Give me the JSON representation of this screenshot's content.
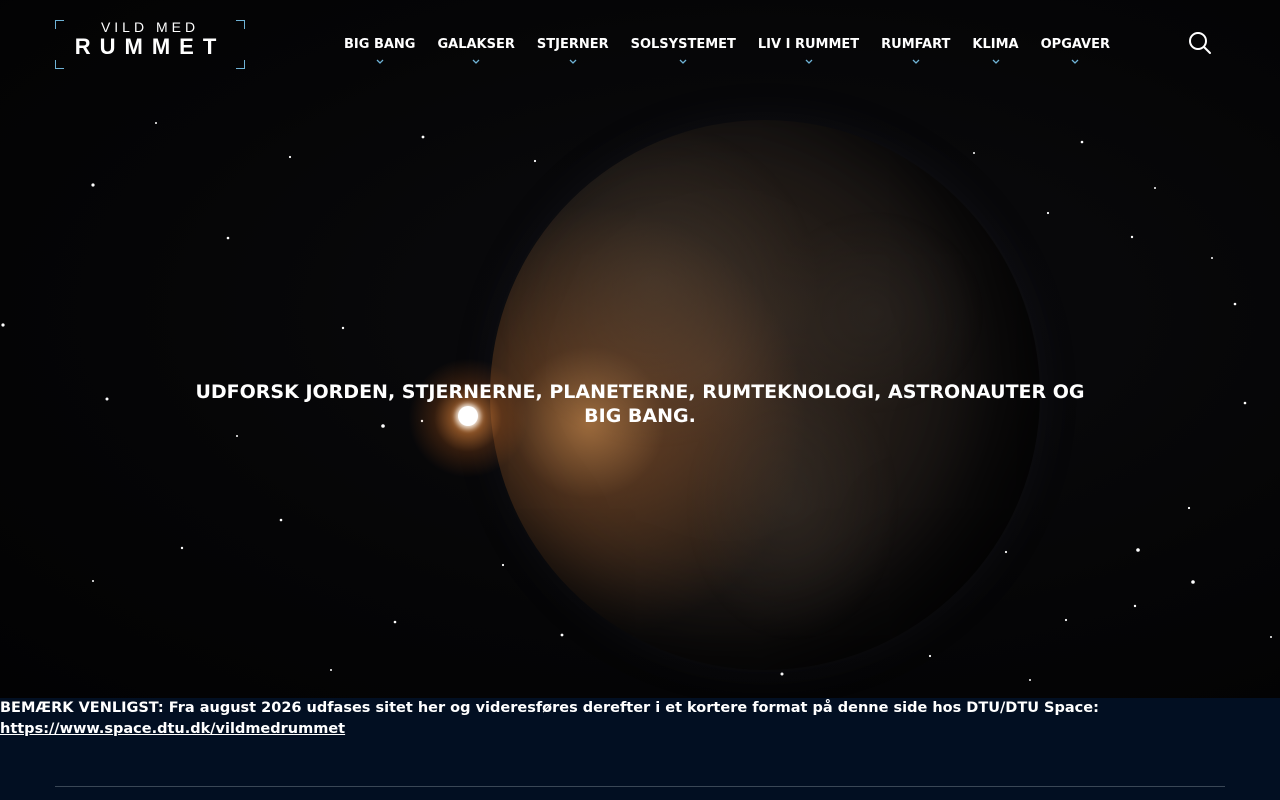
{
  "colors": {
    "background": "#000000",
    "notice_background": "#020f22",
    "accent": "#6fb3d6",
    "text": "#ffffff"
  },
  "logo": {
    "line1": "VILD MED",
    "line2": "RUMMET"
  },
  "nav": {
    "items": [
      {
        "label": "BIG BANG",
        "icon": "chevron-down-icon"
      },
      {
        "label": "GALAKSER",
        "icon": "chevron-down-icon"
      },
      {
        "label": "STJERNER",
        "icon": "chevron-down-icon"
      },
      {
        "label": "SOLSYSTEMET",
        "icon": "chevron-down-icon"
      },
      {
        "label": "LIV I RUMMET",
        "icon": "chevron-down-icon"
      },
      {
        "label": "RUMFART",
        "icon": "chevron-down-icon"
      },
      {
        "label": "KLIMA",
        "icon": "chevron-down-icon"
      },
      {
        "label": "OPGAVER",
        "icon": "chevron-down-icon"
      }
    ]
  },
  "search": {
    "icon": "search-icon"
  },
  "hero": {
    "title": "UDFORSK JORDEN, STJERNERNE, PLANETERNE, RUMTEKNOLOGI, ASTRONAUTER OG BIG BANG."
  },
  "notice": {
    "text": "BEMÆRK VENLIGST: Fra august 2026 udfases sitet her og videresføres derefter i et kortere format på denne side hos DTU/DTU Space:",
    "link": "https://www.space.dtu.dk/vildmedrummet"
  }
}
